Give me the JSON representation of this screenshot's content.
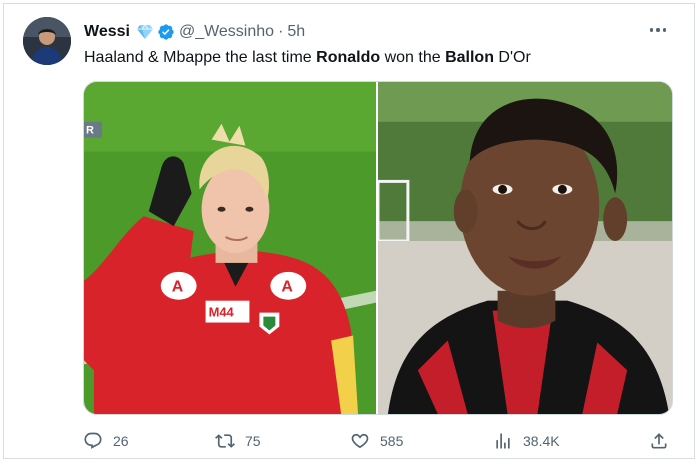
{
  "author": {
    "display_name": "Wessi",
    "handle": "@_Wessinho",
    "separator": "·",
    "time": "5h",
    "badges": [
      "diamond-icon",
      "verified-icon"
    ]
  },
  "tweet": {
    "text_parts": [
      {
        "text": "Haaland & Mbappe the last time ",
        "bold": false
      },
      {
        "text": "Ronaldo",
        "bold": true
      },
      {
        "text": " won the ",
        "bold": false
      },
      {
        "text": "Ballon",
        "bold": true
      },
      {
        "text": " D'Or",
        "bold": false
      }
    ]
  },
  "media": {
    "left_photo": {
      "badge_text": "M44",
      "corner_text": "R"
    },
    "right_photo": {}
  },
  "actions": {
    "reply": {
      "count": "26",
      "icon": "reply-icon"
    },
    "retweet": {
      "count": "75",
      "icon": "retweet-icon"
    },
    "like": {
      "count": "585",
      "icon": "heart-icon"
    },
    "views": {
      "count": "38.4K",
      "icon": "views-icon"
    },
    "share": {
      "icon": "share-icon"
    }
  },
  "colors": {
    "verified_blue": "#1d9bf0",
    "muted_text": "#536471",
    "jersey_red": "#d8232a"
  }
}
